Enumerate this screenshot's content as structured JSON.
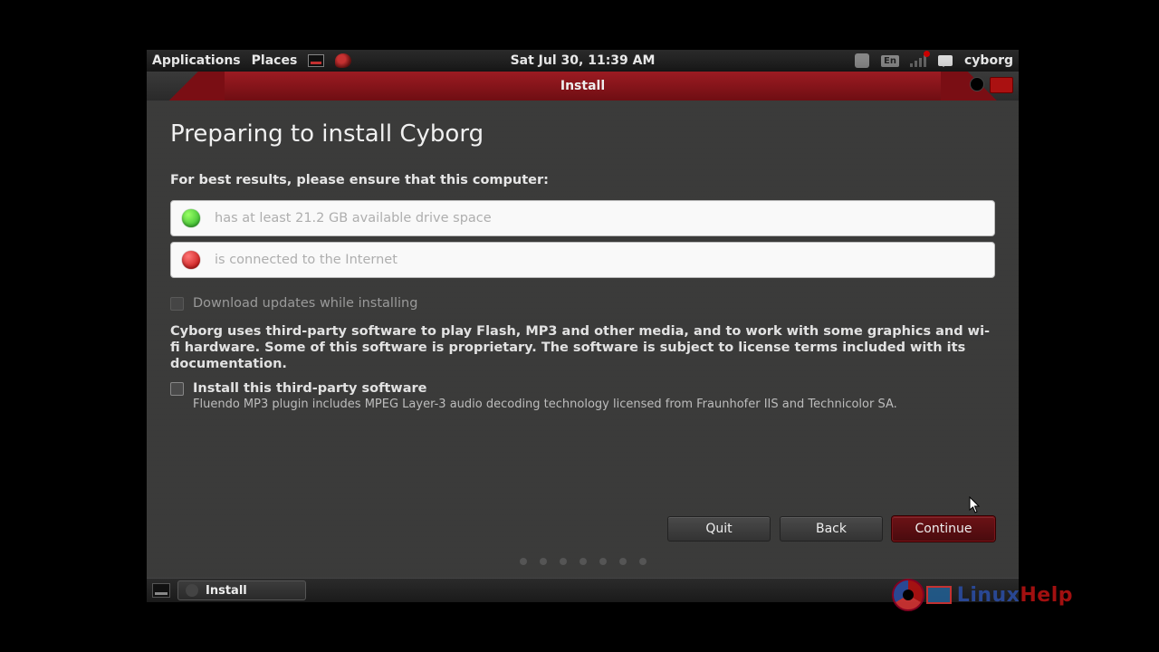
{
  "topbar": {
    "applications": "Applications",
    "places": "Places",
    "clock": "Sat Jul 30, 11:39 AM",
    "lang": "En",
    "username": "cyborg"
  },
  "window": {
    "title": "Install",
    "heading": "Preparing to install Cyborg",
    "subhead": "For best results, please ensure that this computer:",
    "check_space": "has at least 21.2 GB available drive space",
    "check_net": "is connected to the Internet",
    "cb_updates": "Download updates while installing",
    "para_thirdparty": "Cyborg uses third-party software to play Flash, MP3 and other media, and to work with some graphics and wi-fi hardware. Some of this software is proprietary. The software is subject to license terms included with its documentation.",
    "cb_thirdparty": "Install this third-party software",
    "sub_thirdparty": "Fluendo MP3 plugin includes MPEG Layer-3 audio decoding technology licensed from Fraunhofer IIS and Technicolor SA.",
    "btn_quit": "Quit",
    "btn_back": "Back",
    "btn_continue": "Continue"
  },
  "taskbar": {
    "task_label": "Install"
  },
  "watermark": {
    "text1": "Linux",
    "text2": "Help"
  }
}
